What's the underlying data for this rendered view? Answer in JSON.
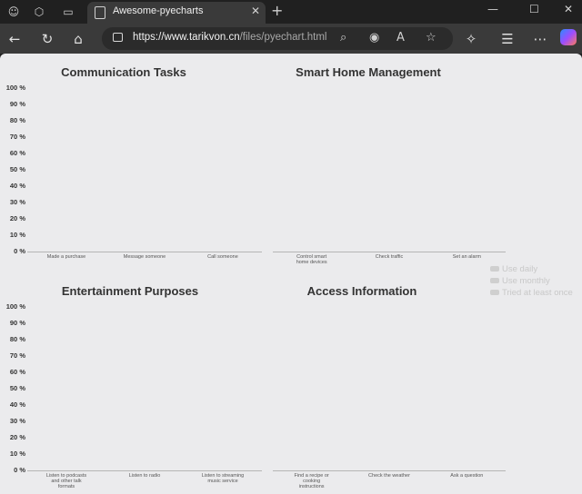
{
  "browser": {
    "tab_title": "Awesome-pyecharts",
    "url_host": "https://www.tarikvon.cn",
    "url_path": "/files/pyechart.html"
  },
  "y_ticks": [
    "100 %",
    "90 %",
    "80 %",
    "70 %",
    "60 %",
    "50 %",
    "40 %",
    "30 %",
    "20 %",
    "10 %",
    "0 %"
  ],
  "charts": [
    {
      "title": "Communication Tasks",
      "categories": [
        "Made a purchase",
        "Message someone",
        "Call someone"
      ]
    },
    {
      "title": "Smart Home Management",
      "categories": [
        "Control smart home devices",
        "Check traffic",
        "Set an alarm"
      ]
    },
    {
      "title": "Entertainment Purposes",
      "categories": [
        "Listen to podcasts and other talk formats",
        "Listen to radio",
        "Listen to streaming music service"
      ]
    },
    {
      "title": "Access Information",
      "categories": [
        "Find a recipe or cooking instructions",
        "Check the weather",
        "Ask a question"
      ]
    }
  ],
  "legend": [
    "Use daily",
    "Use monthly",
    "Tried at least once"
  ],
  "chart_data": [
    {
      "type": "bar",
      "title": "Communication Tasks",
      "categories": [
        "Made a purchase",
        "Message someone",
        "Call someone"
      ],
      "ylim": [
        0,
        100
      ]
    },
    {
      "type": "bar",
      "title": "Smart Home Management",
      "categories": [
        "Control smart home devices",
        "Check traffic",
        "Set an alarm"
      ],
      "ylim": [
        0,
        100
      ]
    },
    {
      "type": "bar",
      "title": "Entertainment Purposes",
      "categories": [
        "Listen to podcasts and other talk formats",
        "Listen to radio",
        "Listen to streaming music service"
      ],
      "ylim": [
        0,
        100
      ]
    },
    {
      "type": "bar",
      "title": "Access Information",
      "categories": [
        "Find a recipe or cooking instructions",
        "Check the weather",
        "Ask a question"
      ],
      "ylim": [
        0,
        100
      ]
    }
  ]
}
